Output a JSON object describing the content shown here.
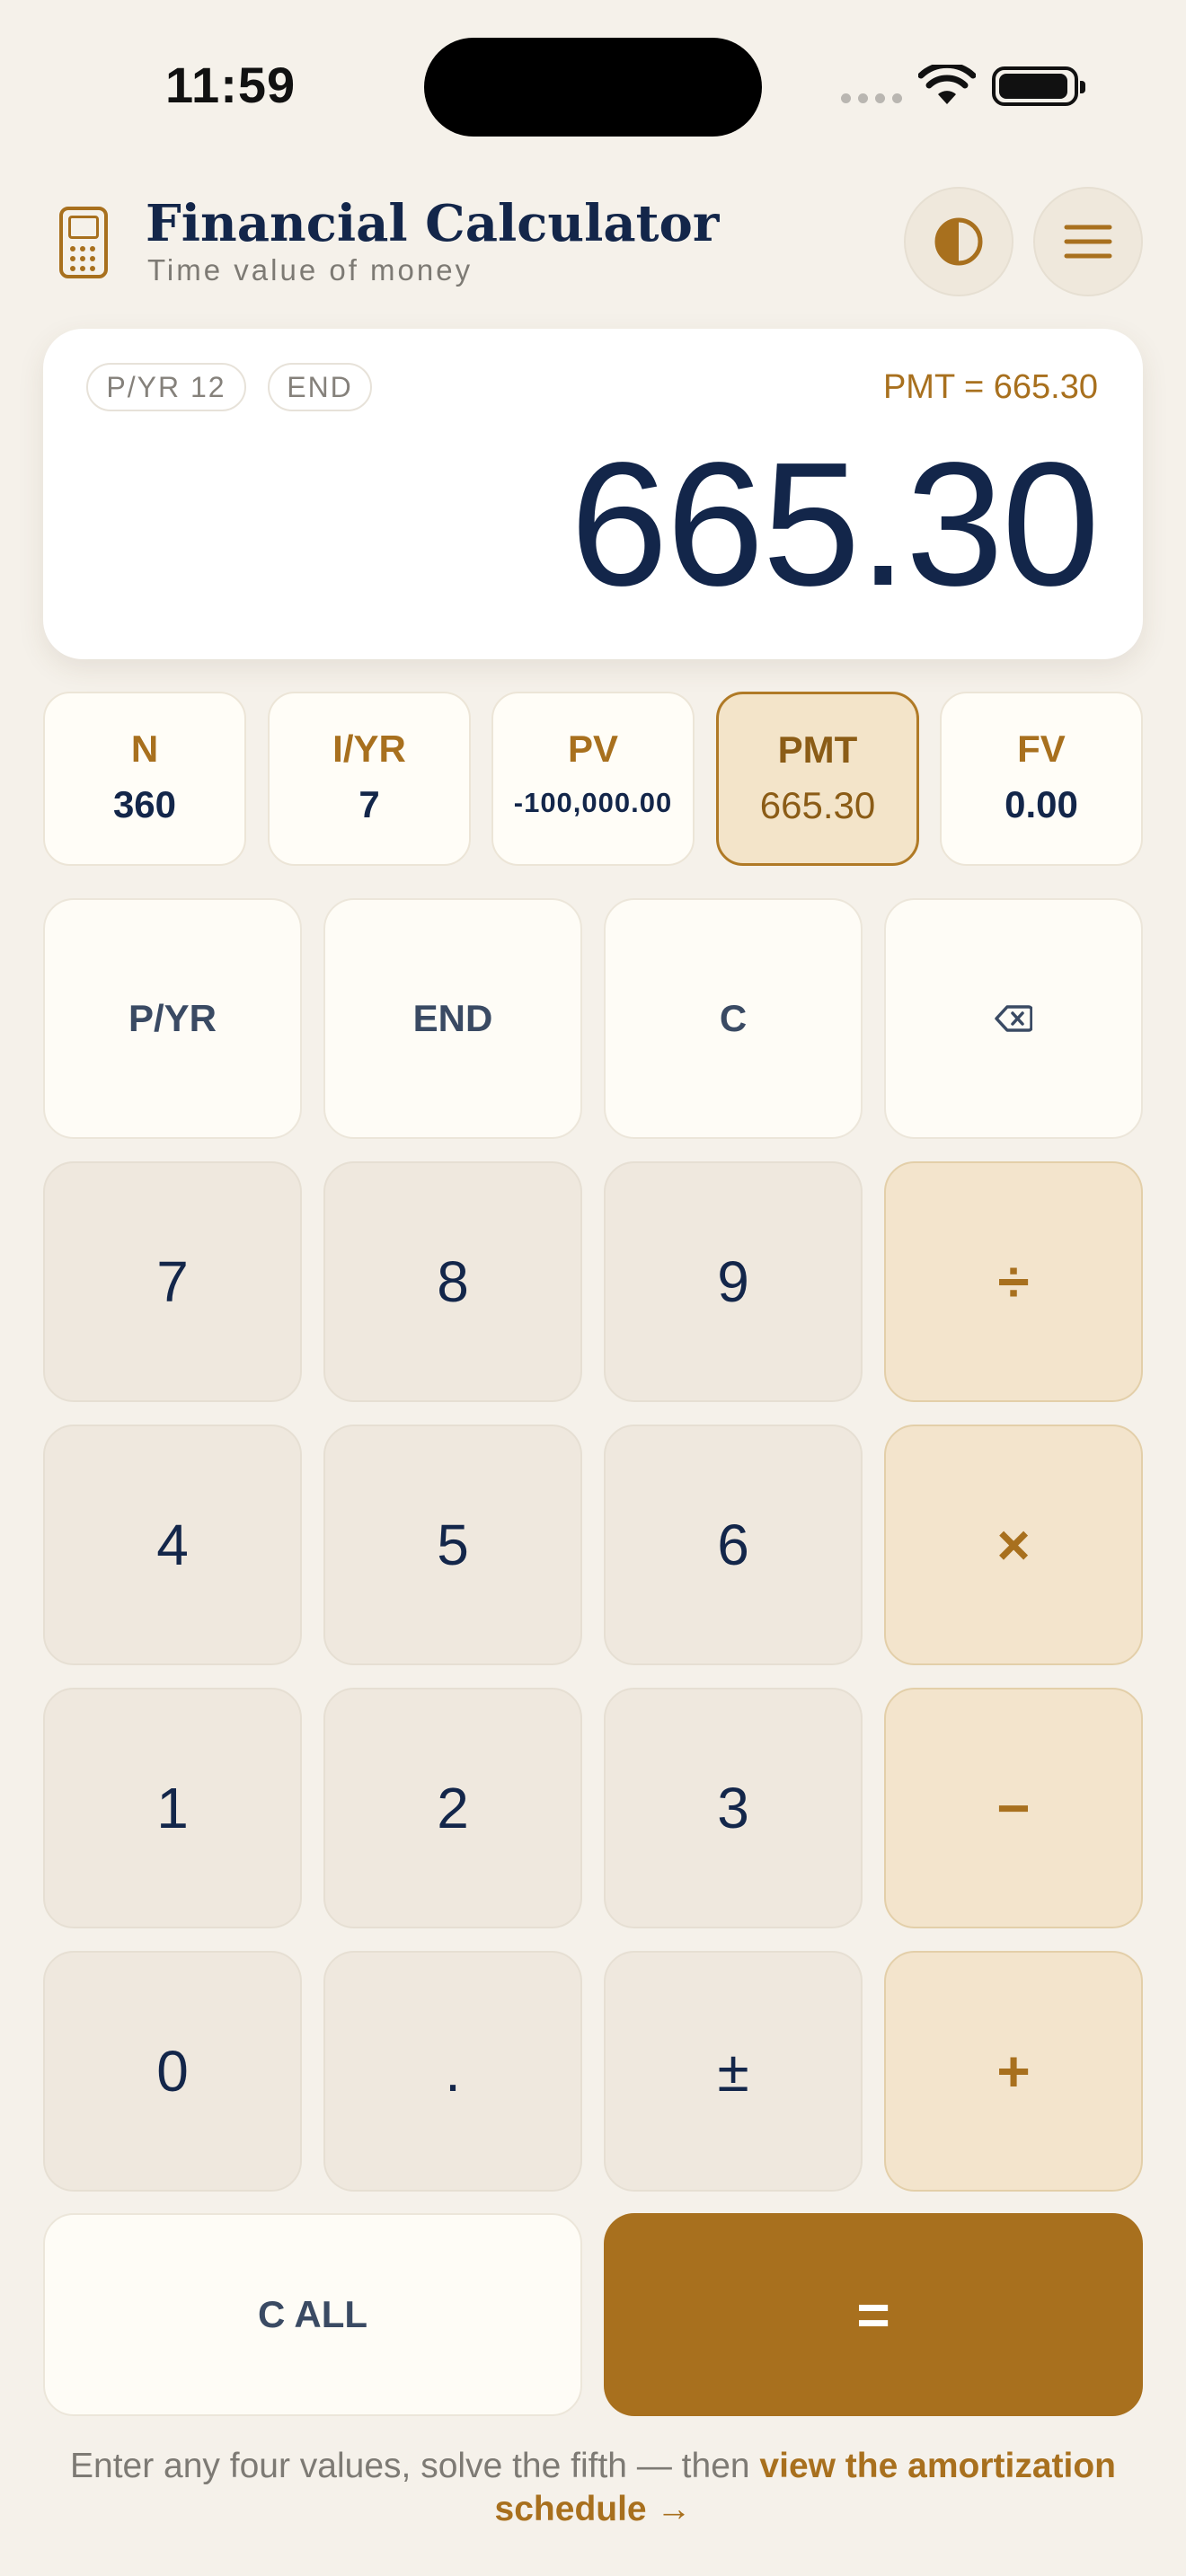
{
  "status": {
    "time": "11:59"
  },
  "header": {
    "title": "Financial Calculator",
    "subtitle": "Time value of money"
  },
  "display": {
    "pills": [
      "P/YR 12",
      "END"
    ],
    "expression": "PMT = 665.30",
    "value": "665.30"
  },
  "registers": [
    {
      "label": "N",
      "value": "360"
    },
    {
      "label": "I/YR",
      "value": "7"
    },
    {
      "label": "PV",
      "value": "-100,000.00"
    },
    {
      "label": "PMT",
      "value": "665.30"
    },
    {
      "label": "FV",
      "value": "0.00"
    }
  ],
  "keys": {
    "pyr": "P/YR",
    "end": "END",
    "clear": "C",
    "k7": "7",
    "k8": "8",
    "k9": "9",
    "divide": "÷",
    "k4": "4",
    "k5": "5",
    "k6": "6",
    "multiply": "×",
    "k1": "1",
    "k2": "2",
    "k3": "3",
    "minus": "−",
    "k0": "0",
    "dot": ".",
    "sign": "±",
    "plus": "+",
    "clear_all": "C ALL",
    "equals": "="
  },
  "footer": {
    "text": "Enter any four values, solve the fifth — then ",
    "link": "view the amortization schedule →"
  },
  "colors": {
    "accent": "#a8701e",
    "navy": "#13264a",
    "background": "#f5f1ea"
  }
}
